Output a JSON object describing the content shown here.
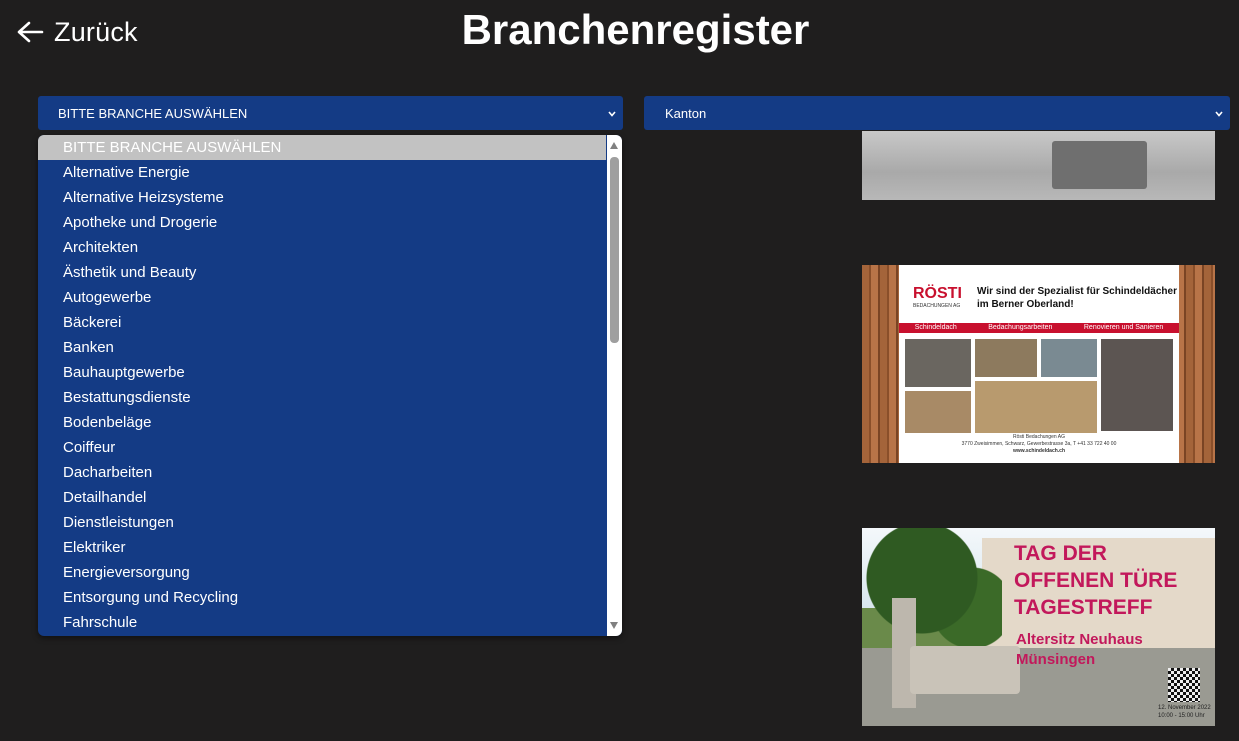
{
  "header": {
    "back_label": "Zurück",
    "title": "Branchenregister"
  },
  "filters": {
    "branche_selected": "BITTE BRANCHE AUSWÄHLEN",
    "kanton_selected": "Kanton"
  },
  "dropdown": {
    "items": [
      "BITTE BRANCHE AUSWÄHLEN",
      "Alternative Energie",
      "Alternative Heizsysteme",
      "Apotheke und Drogerie",
      "Architekten",
      "Ästhetik und Beauty",
      "Autogewerbe",
      "Bäckerei",
      "Banken",
      "Bauhauptgewerbe",
      "Bestattungsdienste",
      "Bodenbeläge",
      "Coiffeur",
      "Dacharbeiten",
      "Detailhandel",
      "Dienstleistungen",
      "Elektriker",
      "Energieversorgung",
      "Entsorgung und Recycling",
      "Fahrschule"
    ],
    "selected_index": 0
  },
  "ads": {
    "ad2": {
      "logo": "RÖSTI",
      "logo_sub": "BEDACHUNGEN AG",
      "headline": "Wir sind der Spezialist für Schindeldächer im Berner Oberland!",
      "bar_items": [
        "Schindeldach",
        "Bedachungsarbeiten",
        "Renovieren und Sanieren"
      ],
      "footer_line1": "Rösti Bedachungen AG",
      "footer_line2": "3770 Zweisimmen, Schwarz, Gewerbestrasse 3a, T +41 33 722 40 00",
      "footer_line3": "www.schindeldach.ch"
    },
    "ad3": {
      "headline": "TAG DER OFFENEN TÜRE TAGESTREFF",
      "sub1": "Altersitz Neuhaus",
      "sub2": "Münsingen",
      "date1": "12. November 2022",
      "date2": "10:00 - 15:00 Uhr"
    }
  },
  "colors": {
    "background": "#1f1e1e",
    "select_blue": "#143b85",
    "selected_item": "#c2c2c2",
    "accent_red": "#c8102e"
  }
}
